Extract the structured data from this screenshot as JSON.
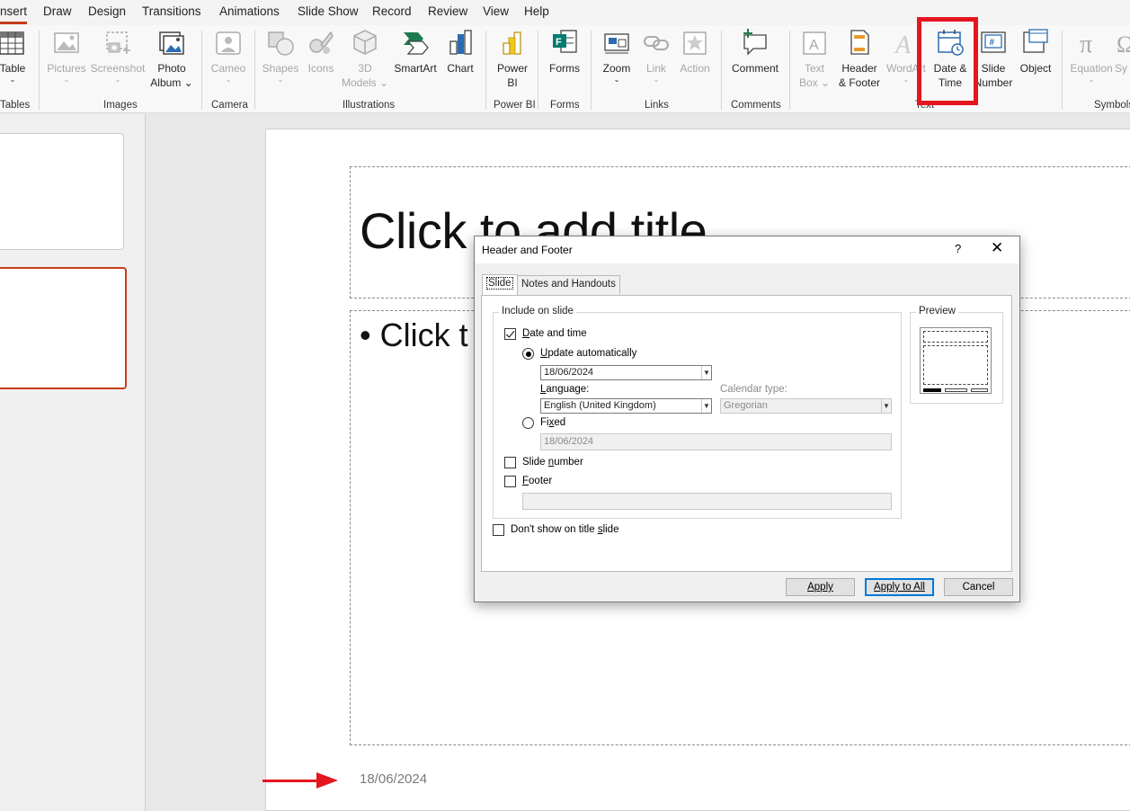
{
  "menu": {
    "tabs": [
      "nsert",
      "Draw",
      "Design",
      "Transitions",
      "Animations",
      "Slide Show",
      "Record",
      "Review",
      "View",
      "Help"
    ]
  },
  "ribbon": {
    "table": {
      "label": "Table",
      "chev": "⌄"
    },
    "pictures": {
      "label": "Pictures",
      "chev": "⌄"
    },
    "screenshot": {
      "label": "Screenshot",
      "chev": "⌄"
    },
    "photo_album": {
      "label1": "Photo",
      "label2": "Album ⌄"
    },
    "cameo": {
      "label": "Cameo",
      "chev": "⌄"
    },
    "shapes": {
      "label": "Shapes",
      "chev": "⌄"
    },
    "icons": {
      "label": "Icons"
    },
    "models3d": {
      "label1": "3D",
      "label2": "Models ⌄"
    },
    "smartart": {
      "label": "SmartArt"
    },
    "chart": {
      "label": "Chart"
    },
    "powerbi": {
      "label1": "Power",
      "label2": "BI"
    },
    "forms": {
      "label": "Forms"
    },
    "zoom": {
      "label": "Zoom",
      "chev": "⌄"
    },
    "link": {
      "label": "Link",
      "chev": "⌄"
    },
    "action": {
      "label": "Action"
    },
    "comment": {
      "label": "Comment"
    },
    "textbox": {
      "label1": "Text",
      "label2": "Box ⌄"
    },
    "header_footer": {
      "label1": "Header",
      "label2": "& Footer"
    },
    "wordart": {
      "label": "WordArt",
      "chev": "⌄"
    },
    "date_time": {
      "label1": "Date &",
      "label2": "Time"
    },
    "slide_number": {
      "label1": "Slide",
      "label2": "Number"
    },
    "object": {
      "label": "Object"
    },
    "equation": {
      "label": "Equation",
      "chev": "⌄"
    },
    "symbol": {
      "label": "Sy"
    },
    "groups": [
      "Tables",
      "Images",
      "Camera",
      "Illustrations",
      "Power BI",
      "Forms",
      "Links",
      "Comments",
      "Text",
      "Symbols"
    ]
  },
  "slide": {
    "title_placeholder": "Click to add title",
    "body_placeholder": "• Click t",
    "footer_date": "18/06/2024"
  },
  "dialog": {
    "title": "Header and Footer",
    "help": "?",
    "close": "✕",
    "tabs": [
      "Slide",
      "Notes and Handouts"
    ],
    "include_legend": "Include on slide",
    "date_and_time": {
      "label_pre": "",
      "label_u": "D",
      "label_post": "ate and time",
      "checked": true
    },
    "update_auto": {
      "label_pre": "",
      "label_u": "U",
      "label_post": "pdate automatically",
      "selected": true
    },
    "auto_date_value": "18/06/2024",
    "language_label": {
      "pre": "",
      "u": "L",
      "post": "anguage:"
    },
    "language_value": "English (United Kingdom)",
    "calendar_label": "Calendar type:",
    "calendar_value": "Gregorian",
    "fixed": {
      "label_pre": "Fi",
      "label_u": "x",
      "label_post": "ed",
      "selected": false
    },
    "fixed_value": "18/06/2024",
    "slide_number": {
      "label_pre": "Slide ",
      "label_u": "n",
      "label_post": "umber",
      "checked": false
    },
    "footer": {
      "label_pre": "",
      "label_u": "F",
      "label_post": "ooter",
      "checked": false
    },
    "footer_value": "",
    "dont_show": {
      "label_pre": "Don't show on title ",
      "label_u": "s",
      "label_post": "lide",
      "checked": false
    },
    "preview_legend": "Preview",
    "buttons": {
      "apply": "Apply",
      "apply_all": "Apply to All",
      "cancel": "Cancel"
    }
  },
  "colors": {
    "accent": "#c43e1c",
    "annotation": "#e5161f",
    "default_button": "#0078d7"
  }
}
